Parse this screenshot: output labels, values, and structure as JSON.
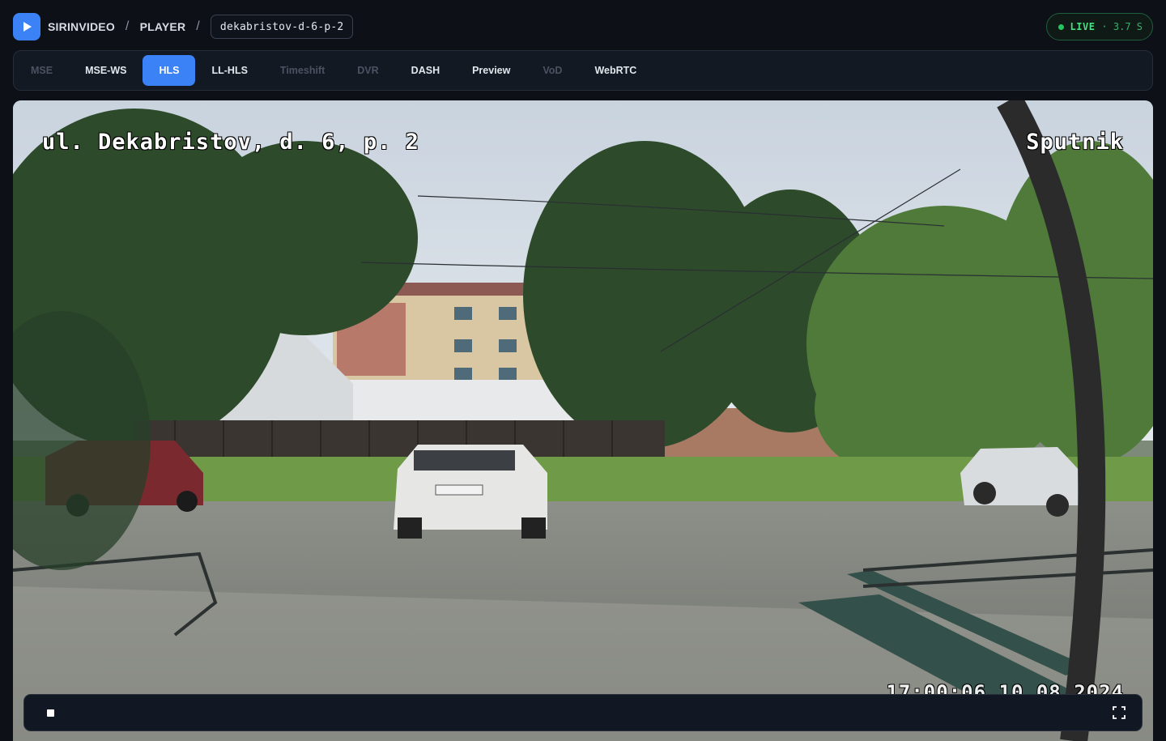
{
  "app": {
    "breadcrumb": [
      "SIRINVIDEO",
      "PLAYER"
    ],
    "breadcrumb_separator": "/",
    "stream_name": "dekabristov-d-6-p-2",
    "logo_icon": "play-icon",
    "accent_color": "#3b82f6"
  },
  "live": {
    "label": "LIVE",
    "latency": "· 3.7 S",
    "color": "#4ade80"
  },
  "tabs": [
    {
      "label": "MSE",
      "state": "disabled"
    },
    {
      "label": "MSE-WS",
      "state": "enabled"
    },
    {
      "label": "HLS",
      "state": "active"
    },
    {
      "label": "LL-HLS",
      "state": "enabled"
    },
    {
      "label": "Timeshift",
      "state": "disabled"
    },
    {
      "label": "DVR",
      "state": "disabled"
    },
    {
      "label": "DASH",
      "state": "enabled"
    },
    {
      "label": "Preview",
      "state": "enabled"
    },
    {
      "label": "VoD",
      "state": "disabled"
    },
    {
      "label": "WebRTC",
      "state": "enabled"
    }
  ],
  "video": {
    "osd_address": "ul. Dekabristov, d. 6, p. 2",
    "osd_brand": "Sputnik",
    "osd_timestamp": "17:00:06 10.08.2024"
  },
  "controls": {
    "stop_icon": "stop-icon",
    "fullscreen_icon": "fullscreen-icon"
  }
}
